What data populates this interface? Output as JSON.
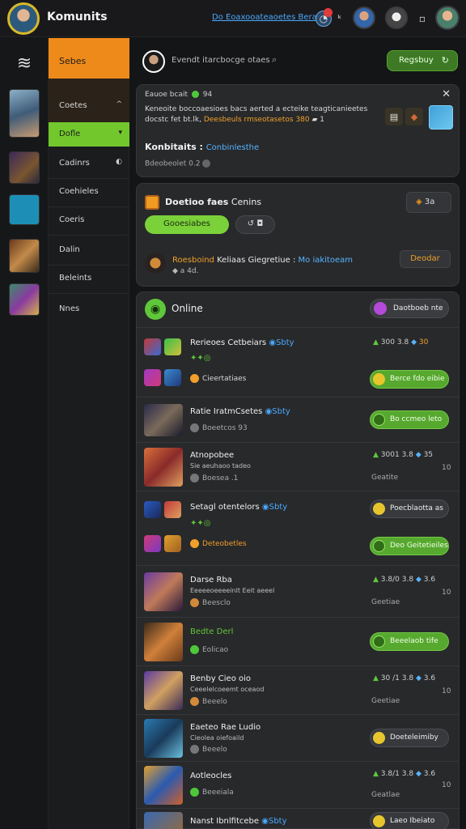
{
  "app": {
    "title": "Komunits"
  },
  "top": {
    "link": "Do Eoaxooateaoetes Berag",
    "badge_color": "#e23b3b"
  },
  "sidebar": {
    "header": "Sebes",
    "items": [
      {
        "label": "Coetes",
        "chev": "^"
      },
      {
        "label": "Dofle",
        "chev": "▾",
        "selected": true
      },
      {
        "label": "Cadinrs",
        "chev": "◐"
      },
      {
        "label": "Coehieles"
      },
      {
        "label": "Coeris"
      },
      {
        "label": "Dalin"
      },
      {
        "label": "Beleints"
      },
      {
        "label": "Nnes"
      }
    ]
  },
  "search": {
    "text": "Evendt itarcbocge otaes",
    "icon": "search-icon"
  },
  "register_button": {
    "label": "Regsbuy",
    "icon": "refresh-icon"
  },
  "notice": {
    "top": "Eauoe bcait",
    "top_num": "94",
    "body_1": "Keneoite boccoaesioes bacs aerted a ecteike teagticanieetes",
    "body_2": "docstc fet bt.lk,",
    "body_orange": "Deesbeuls rmseotasetos 380",
    "body_tail": "▰ 1",
    "title": "Konbitaits :",
    "title_link": "Conbinlesthe",
    "footer": "Bdeobeolet 0.2"
  },
  "event": {
    "title_bold": "Doetioo faes",
    "title_rest": "Cenins",
    "pill": "3a",
    "primary": "Gooesiabes",
    "secondary": "↺  ◘",
    "line_a": "Roesboind",
    "line_b": "Keliaas Giegretiue :",
    "line_c": "Mo iakitoeam",
    "sub": "◆ a 4d.",
    "action": "Deodar"
  },
  "online": {
    "title": "Online",
    "button": "Daotboeb nte",
    "players": [
      {
        "name": "Rerieoes Cetbeiars",
        "tag": "Sbty",
        "stats": [
          "300",
          "3.8",
          "30"
        ],
        "line2": "Cieertatiaes",
        "button": "Berce fdo eibie",
        "btn_style": "green-yellow"
      },
      {
        "name": "Ratie IratmCsetes",
        "tag": "Sbty",
        "meta": "Boeetcos  93",
        "button": "Bo ccmeo leto",
        "btn_style": "green"
      },
      {
        "name": "Atnopobee",
        "sub": "Sie aeuhaoo tadeo",
        "meta": "Boesea  .1",
        "stats": [
          "3001",
          "3.8",
          "35"
        ],
        "extra": "Geatite",
        "n10": "10"
      },
      {
        "name": "Setagl otentelors",
        "tag": "Sbty",
        "line2": "Deteobetles",
        "button": "Poecblaotta as",
        "btn_style": "dark-yellow",
        "button2": "Deo Geitetieiles",
        "btn2_style": "green"
      },
      {
        "name": "Darse Rba",
        "sub": "Eeeeeoeeeeinlt Eeit aeeel",
        "meta": "Beesclo",
        "stats": [
          "3.8/0",
          "3.8",
          "3.6"
        ],
        "extra": "Geetiae",
        "n10": "10"
      },
      {
        "name": "Bedte Derl",
        "meta": "Eolicao",
        "button": "Beeelaob tife",
        "btn_style": "green"
      },
      {
        "name": "Benby Cieo oio",
        "sub": "Ceeelelcoeemt oceaod",
        "meta": "Beeelo",
        "stats": [
          "30 /1",
          "3.8",
          "3.6"
        ],
        "extra": "Geetiae",
        "n10": "10"
      },
      {
        "name": "Eaeteo Rae Ludio",
        "sub": "Cieolea oiefoaild",
        "meta": "Beeelo",
        "button": "Doeteleimiby",
        "btn_style": "dark-yellow"
      },
      {
        "name": "Aotleocles",
        "meta": "Beeeiala",
        "stats": [
          "3.8/1",
          "3.8",
          "3.6"
        ],
        "extra": "Geatlae",
        "n10": "10"
      },
      {
        "name": "Nanst Ibnlfitcebe",
        "tag": "Sbty",
        "button": "Laeo Ibeiato",
        "btn_style": "dark-yellow"
      }
    ]
  },
  "colors": {
    "accent_orange": "#ee8a1a",
    "accent_green": "#72c72c",
    "link_blue": "#4aa9ff"
  }
}
